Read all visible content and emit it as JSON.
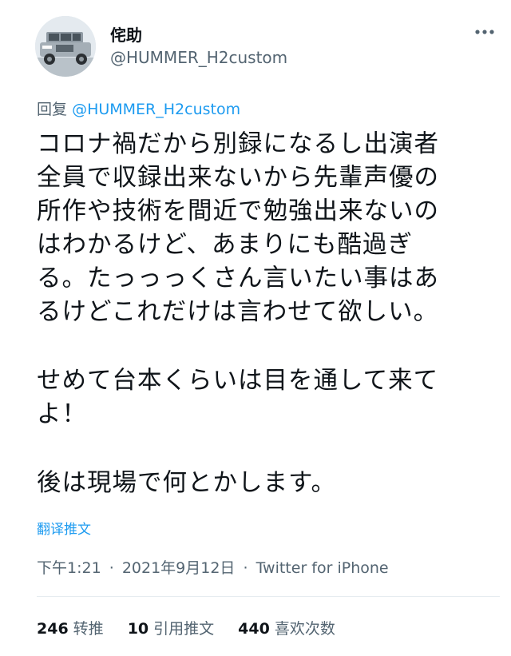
{
  "user": {
    "display_name": "侘助",
    "handle": "@HUMMER_H2custom",
    "avatar_icon": "hummer-car-avatar"
  },
  "menu": {
    "icon": "more-dots-icon"
  },
  "reply": {
    "prefix": "回复",
    "mention": "@HUMMER_H2custom"
  },
  "tweet": {
    "paragraph1": [
      "コロナ禍だから別録になるし出演者",
      "全員で収録出来ないから先輩声優の",
      "所作や技術を間近で勉強出来ないの",
      "はわかるけど、あまりにも酷過ぎ",
      "る。たっっっくさん言いたい事はあ",
      "るけどこれだけは言わせて欲しい。"
    ],
    "paragraph2": [
      "せめて台本くらいは目を通して来て",
      "よ！"
    ],
    "paragraph3": [
      "後は現場で何とかします。"
    ]
  },
  "translate_label": "翻译推文",
  "meta": {
    "time": "下午1:21",
    "date": "2021年9月12日",
    "separator": "·",
    "source": "Twitter for iPhone"
  },
  "stats": {
    "retweets": {
      "count": "246",
      "label": "转推"
    },
    "quotes": {
      "count": "10",
      "label": "引用推文"
    },
    "likes": {
      "count": "440",
      "label": "喜欢次数"
    }
  },
  "colors": {
    "link": "#1d9bf0",
    "secondary_text": "#536471",
    "primary_text": "#0f1419"
  }
}
